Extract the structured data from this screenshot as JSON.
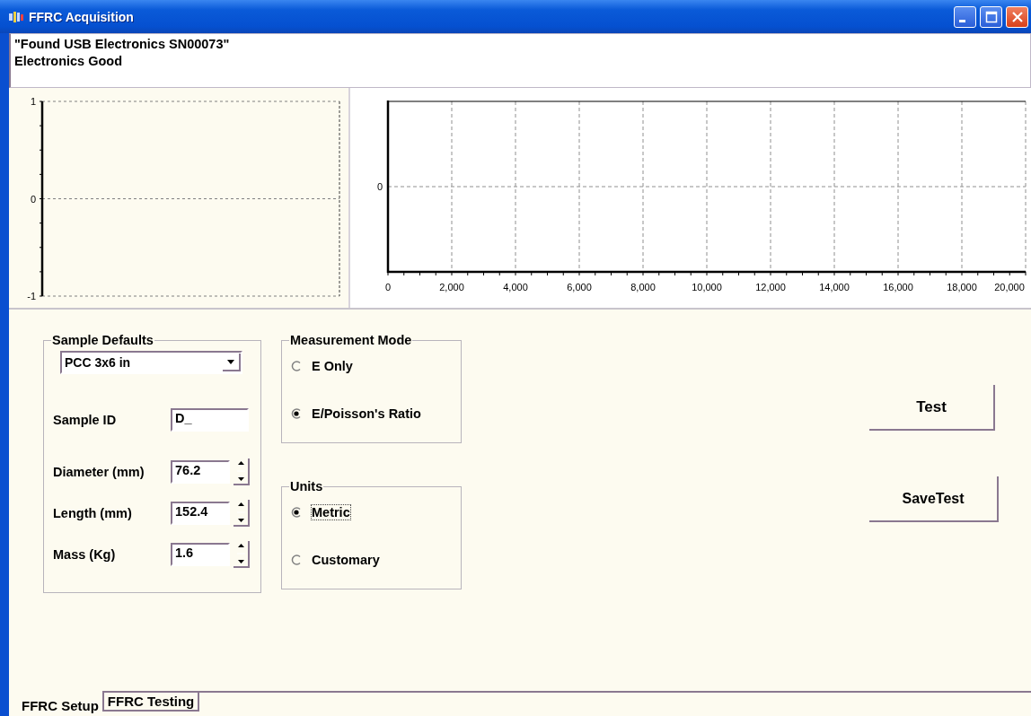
{
  "window": {
    "title": "FFRC Acquisition"
  },
  "status_lines": [
    "\"Found USB Electronics SN00073\"",
    "Electronics Good"
  ],
  "left_chart": {
    "y_axis_labels": [
      "1",
      "0",
      "-1"
    ]
  },
  "right_chart": {
    "y_axis_labels": [
      "0"
    ],
    "x_axis_labels": [
      "0",
      "2,000",
      "4,000",
      "6,000",
      "8,000",
      "10,000",
      "12,000",
      "14,000",
      "16,000",
      "18,000",
      "20,000"
    ]
  },
  "sample_defaults": {
    "title": "Sample Defaults",
    "preset": "PCC 3x6 in",
    "fields": [
      {
        "kind": "text",
        "label": "Sample ID",
        "value": "D_"
      },
      {
        "kind": "spin",
        "label": "Diameter (mm)",
        "value": "76.2"
      },
      {
        "kind": "spin",
        "label": "Length (mm)",
        "value": "152.4"
      },
      {
        "kind": "spin",
        "label": "Mass (Kg)",
        "value": "1.6"
      }
    ]
  },
  "measurement_mode": {
    "title": "Measurement Mode",
    "options": [
      {
        "label": "E Only",
        "selected": false,
        "focused": false
      },
      {
        "label": "E/Poisson's Ratio",
        "selected": true,
        "focused": false
      }
    ]
  },
  "units": {
    "title": "Units",
    "options": [
      {
        "label": "Metric",
        "selected": true,
        "focused": true
      },
      {
        "label": "Customary",
        "selected": false,
        "focused": false
      }
    ]
  },
  "buttons": [
    "Test",
    "SaveTest"
  ],
  "tabs": [
    {
      "label": "FFRC Setup",
      "selected": true
    },
    {
      "label": "FFRC Testing",
      "selected": false
    }
  ]
}
